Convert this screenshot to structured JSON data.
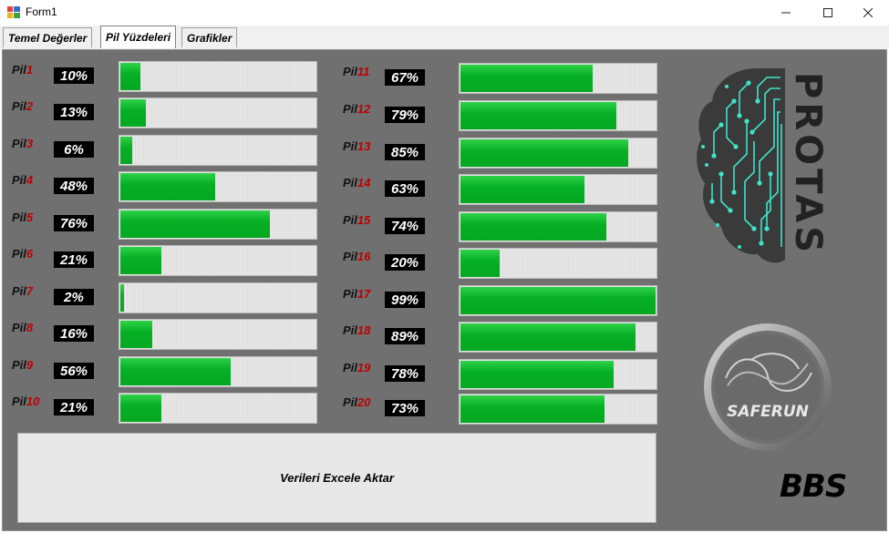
{
  "window": {
    "title": "Form1",
    "minimize_icon": "minimize-icon",
    "maximize_icon": "maximize-icon",
    "close_icon": "close-icon"
  },
  "tabs": [
    {
      "label": "Temel Değerler",
      "active": false
    },
    {
      "label": "Pil Yüzdeleri",
      "active": true
    },
    {
      "label": "Grafikler",
      "active": false
    }
  ],
  "batteries_left": [
    {
      "prefix": "Pil",
      "num": "1",
      "value": 10,
      "text": "10%"
    },
    {
      "prefix": "Pil",
      "num": "2",
      "value": 13,
      "text": "13%"
    },
    {
      "prefix": "Pil",
      "num": "3",
      "value": 6,
      "text": "6%"
    },
    {
      "prefix": "Pil",
      "num": "4",
      "value": 48,
      "text": "48%"
    },
    {
      "prefix": "Pil",
      "num": "5",
      "value": 76,
      "text": "76%"
    },
    {
      "prefix": "Pil",
      "num": "6",
      "value": 21,
      "text": "21%"
    },
    {
      "prefix": "Pil",
      "num": "7",
      "value": 2,
      "text": "2%"
    },
    {
      "prefix": "Pil",
      "num": "8",
      "value": 16,
      "text": "16%"
    },
    {
      "prefix": "Pil",
      "num": "9",
      "value": 56,
      "text": "56%"
    },
    {
      "prefix": "Pil",
      "num": "10",
      "value": 21,
      "text": "21%"
    }
  ],
  "batteries_right": [
    {
      "prefix": "Pil",
      "num": "11",
      "value": 67,
      "text": "67%"
    },
    {
      "prefix": "Pil",
      "num": "12",
      "value": 79,
      "text": "79%"
    },
    {
      "prefix": "Pil",
      "num": "13",
      "value": 85,
      "text": "85%"
    },
    {
      "prefix": "Pil",
      "num": "14",
      "value": 63,
      "text": "63%"
    },
    {
      "prefix": "Pil",
      "num": "15",
      "value": 74,
      "text": "74%"
    },
    {
      "prefix": "Pil",
      "num": "16",
      "value": 20,
      "text": "20%"
    },
    {
      "prefix": "Pil",
      "num": "17",
      "value": 99,
      "text": "99%"
    },
    {
      "prefix": "Pil",
      "num": "18",
      "value": 89,
      "text": "89%"
    },
    {
      "prefix": "Pil",
      "num": "19",
      "value": 78,
      "text": "78%"
    },
    {
      "prefix": "Pil",
      "num": "20",
      "value": 73,
      "text": "73%"
    }
  ],
  "export_button": {
    "label": "Verileri Excele Aktar"
  },
  "logos": {
    "protas": "PROTAS",
    "saferun": "SAFERUN",
    "bbs": "BBS"
  },
  "colors": {
    "fill": "#06b025",
    "panel_bg": "#707070",
    "pil_number": "#c00000"
  }
}
